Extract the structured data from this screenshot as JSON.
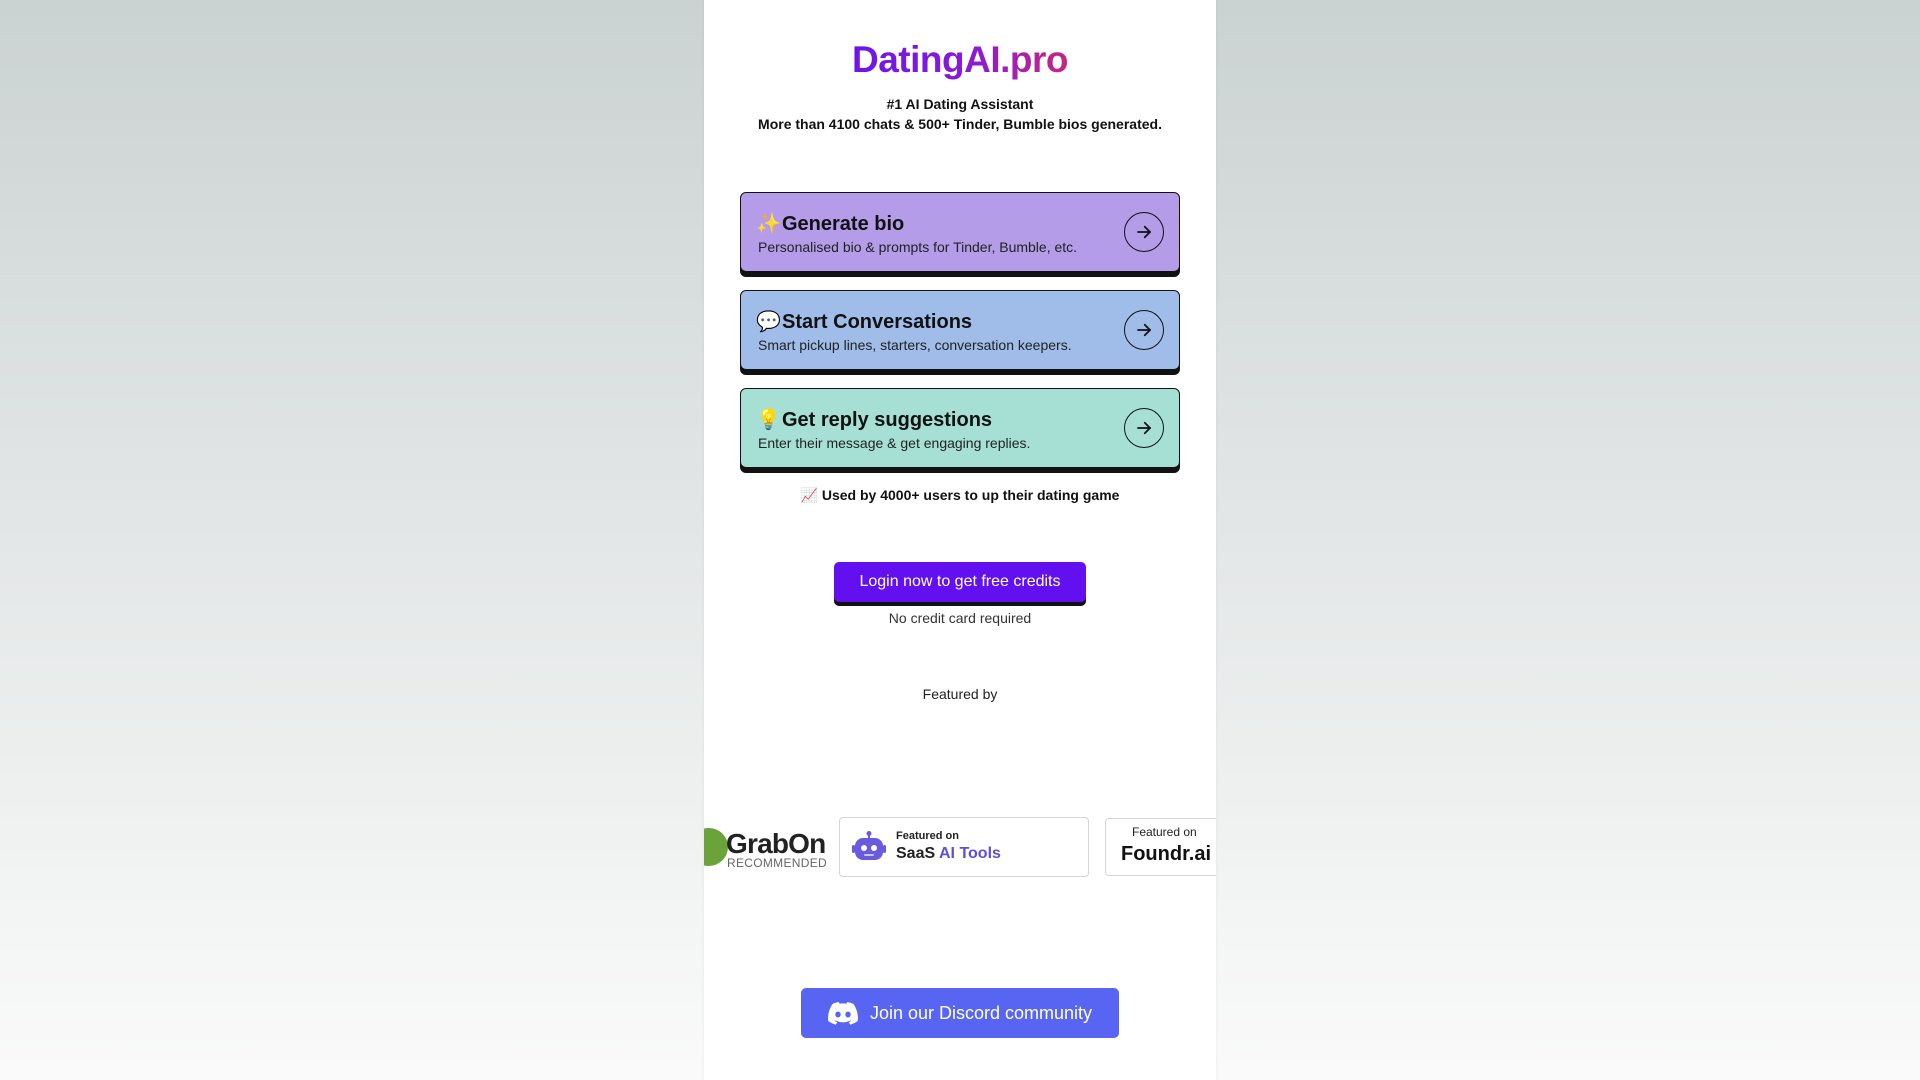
{
  "brand": {
    "name": "DatingAI.pro"
  },
  "hero": {
    "tagline": "#1 AI Dating Assistant",
    "stats_line": "More than 4100 chats & 500+ Tinder, Bumble bios generated."
  },
  "features": [
    {
      "emoji": "✨",
      "title": "Generate bio",
      "subtitle": "Personalised bio & prompts for Tinder, Bumble, etc.",
      "color": "#b49ce9",
      "icon": "arrow-right-icon"
    },
    {
      "emoji": "💬",
      "title": "Start Conversations",
      "subtitle": "Smart pickup lines, starters, conversation keepers.",
      "color": "#a0bce9",
      "icon": "arrow-right-icon"
    },
    {
      "emoji": "💡",
      "title": "Get reply suggestions",
      "subtitle": "Enter their message & get engaging replies.",
      "color": "#a6e0d4",
      "icon": "arrow-right-icon"
    }
  ],
  "social_proof": {
    "emoji": "📈",
    "text": "Used by 4000+ users to up their dating game"
  },
  "cta": {
    "login_label": "Login now to get free credits",
    "login_color": "#6210f0",
    "note": "No credit card required"
  },
  "featured_by": {
    "heading": "Featured by",
    "badges": [
      {
        "name": "GrabOn",
        "caption": "RECOMMENDED",
        "icon": "grabon-logo-icon"
      },
      {
        "prefix": "Featured on",
        "name_part1": "SaaS",
        "name_part2": "AI Tools",
        "icon": "robot-icon"
      },
      {
        "prefix": "Featured on",
        "name": "Foundr.ai"
      }
    ]
  },
  "discord": {
    "label": "Join our Discord community",
    "color": "#5865f2",
    "icon": "discord-icon"
  }
}
